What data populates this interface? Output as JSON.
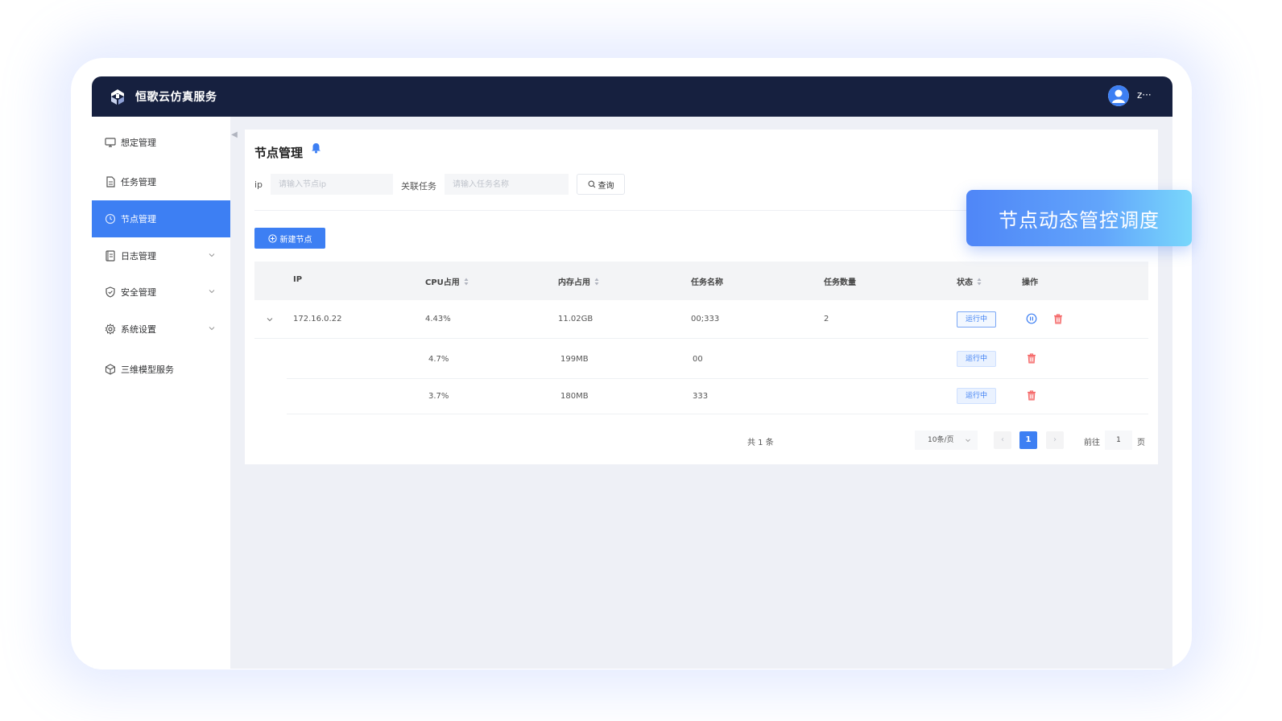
{
  "app": {
    "title": "恒歌云仿真服务",
    "user_name": "z···"
  },
  "sidebar": {
    "items": [
      {
        "label": "想定管理",
        "icon": "monitor-icon",
        "active": false,
        "has_children": false
      },
      {
        "label": "任务管理",
        "icon": "document-icon",
        "active": false,
        "has_children": false
      },
      {
        "label": "节点管理",
        "icon": "clock-icon",
        "active": true,
        "has_children": false
      },
      {
        "label": "日志管理",
        "icon": "log-icon",
        "active": false,
        "has_children": true
      },
      {
        "label": "安全管理",
        "icon": "shield-icon",
        "active": false,
        "has_children": true
      },
      {
        "label": "系统设置",
        "icon": "gear-icon",
        "active": false,
        "has_children": true
      },
      {
        "label": "三维模型服务",
        "icon": "cube-icon",
        "active": false,
        "has_children": false
      }
    ]
  },
  "page": {
    "title": "节点管理"
  },
  "filters": {
    "ip_label": "ip",
    "ip_placeholder": "请输入节点ip",
    "task_label": "关联任务",
    "task_placeholder": "请输入任务名称",
    "query_label": "查询"
  },
  "toolbar": {
    "new_node_label": "新建节点"
  },
  "table": {
    "columns": [
      "IP",
      "CPU占用",
      "内存占用",
      "任务名称",
      "任务数量",
      "状态",
      "操作"
    ],
    "rows": [
      {
        "ip": "172.16.0.22",
        "cpu": "4.43%",
        "memory": "11.02GB",
        "task_name": "00;333",
        "task_count": "2",
        "status": "运行中"
      }
    ],
    "children": [
      {
        "cpu": "4.7%",
        "memory": "199MB",
        "task_name": "00",
        "status": "运行中"
      },
      {
        "cpu": "3.7%",
        "memory": "180MB",
        "task_name": "333",
        "status": "运行中"
      }
    ]
  },
  "pagination": {
    "total": "共 1 条",
    "page_size": "10条/页",
    "current_page": "1",
    "goto_label": "前往",
    "goto_value": "1",
    "page_unit": "页"
  },
  "callout": {
    "text": "节点动态管控调度"
  },
  "colors": {
    "topbar": "#16203f",
    "accent": "#3d7ff3",
    "danger": "#f56c6c"
  }
}
